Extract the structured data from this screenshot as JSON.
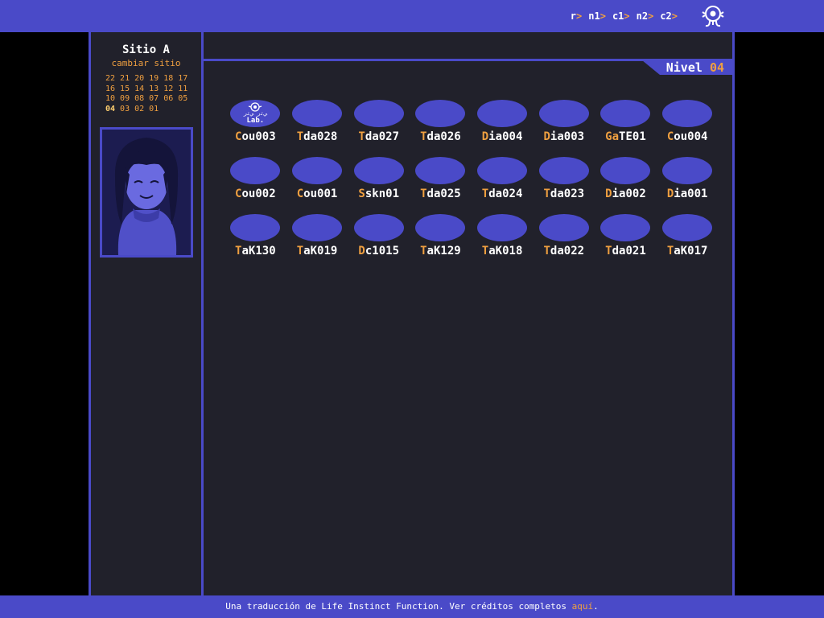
{
  "breadcrumbs": [
    {
      "label": "r",
      "sep": ">"
    },
    {
      "label": "n1",
      "sep": ">"
    },
    {
      "label": "c1",
      "sep": ">"
    },
    {
      "label": "n2",
      "sep": ">"
    },
    {
      "label": "c2",
      "sep": ">"
    }
  ],
  "sidebar": {
    "title": "Sitio A",
    "change_site": "cambiar sitio",
    "level_rows": [
      [
        "22",
        "21",
        "20",
        "19",
        "18",
        "17"
      ],
      [
        "16",
        "15",
        "14",
        "13",
        "12",
        "11"
      ],
      [
        "10",
        "09",
        "08",
        "07",
        "06",
        "05"
      ],
      [
        "04",
        "03",
        "02",
        "01"
      ]
    ],
    "current_level": "04"
  },
  "level_tab": {
    "label": "Nivel",
    "value": "04"
  },
  "nodes": [
    {
      "first": "C",
      "rest": "ou003",
      "lab": true
    },
    {
      "first": "T",
      "rest": "da028"
    },
    {
      "first": "T",
      "rest": "da027"
    },
    {
      "first": "T",
      "rest": "da026"
    },
    {
      "first": "D",
      "rest": "ia004"
    },
    {
      "first": "D",
      "rest": "ia003"
    },
    {
      "first": "Ga",
      "rest": "TE01"
    },
    {
      "first": "C",
      "rest": "ou004"
    },
    {
      "first": "C",
      "rest": "ou002"
    },
    {
      "first": "C",
      "rest": "ou001"
    },
    {
      "first": "S",
      "rest": "skn01"
    },
    {
      "first": "T",
      "rest": "da025"
    },
    {
      "first": "T",
      "rest": "da024"
    },
    {
      "first": "T",
      "rest": "da023"
    },
    {
      "first": "D",
      "rest": "ia002"
    },
    {
      "first": "D",
      "rest": "ia001"
    },
    {
      "first": "T",
      "rest": "aK130"
    },
    {
      "first": "T",
      "rest": "aK019"
    },
    {
      "first": "D",
      "rest": "c1015"
    },
    {
      "first": "T",
      "rest": "aK129"
    },
    {
      "first": "T",
      "rest": "aK018"
    },
    {
      "first": "T",
      "rest": "da022"
    },
    {
      "first": "T",
      "rest": "da021"
    },
    {
      "first": "T",
      "rest": "aK017"
    }
  ],
  "lab_badge": {
    "top": "ﻲﺗﺭ ﻲﺗﺭ",
    "bottom": "Lab."
  },
  "footer": {
    "text": "Una traducción de Life Instinct Function. Ver créditos completos ",
    "link": "aquí",
    "end": "."
  },
  "colors": {
    "accent": "#4a4ac8",
    "highlight": "#f0a040",
    "panel": "#21212b"
  }
}
